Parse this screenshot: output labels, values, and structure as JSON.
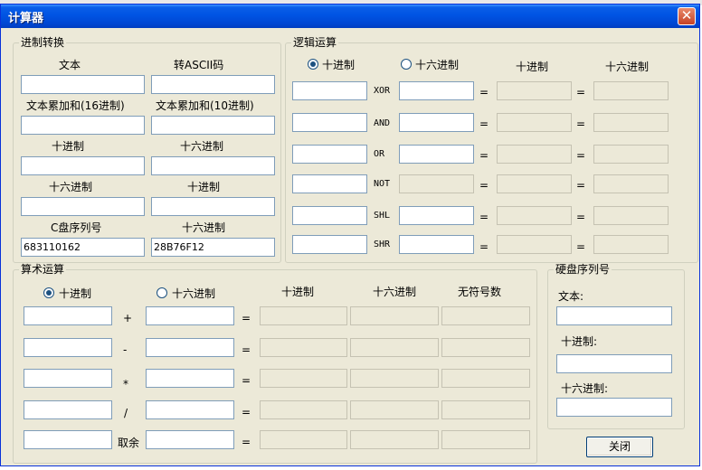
{
  "window": {
    "title": "计算器",
    "close_label": "✕"
  },
  "base_panel": {
    "legend": "进制转换",
    "labels": {
      "text": "文本",
      "to_ascii": "转ASCII码",
      "sum_hex": "文本累加和(16进制)",
      "sum_dec": "文本累加和(10进制)",
      "dec": "十进制",
      "hex": "十六进制",
      "hex2": "十六进制",
      "dec2": "十进制",
      "c_serial": "C盘序列号",
      "hex3": "十六进制"
    },
    "values": {
      "c_serial": "683110162",
      "c_serial_hex": "28B76F12"
    }
  },
  "logic_panel": {
    "legend": "逻辑运算",
    "radio_dec": "十进制",
    "radio_hex": "十六进制",
    "col_dec": "十进制",
    "col_hex": "十六进制",
    "ops": [
      "XOR",
      "AND",
      "OR",
      "NOT",
      "SHL",
      "SHR"
    ],
    "eq": "="
  },
  "arith_panel": {
    "legend": "算术运算",
    "radio_dec": "十进制",
    "radio_hex": "十六进制",
    "col_dec": "十进制",
    "col_hex": "十六进制",
    "col_unsigned": "无符号数",
    "ops": [
      "+",
      "-",
      "*",
      "/",
      "取余"
    ],
    "eq": "="
  },
  "disk_panel": {
    "legend": "硬盘序列号",
    "text_label": "文本:",
    "dec_label": "十进制:",
    "hex_label": "十六进制:"
  },
  "buttons": {
    "close": "关闭"
  },
  "colors": {
    "titlebar": "#0054e3",
    "window_bg": "#ece9d8",
    "field_border": "#7f9db9",
    "close_button": "#c64226"
  }
}
